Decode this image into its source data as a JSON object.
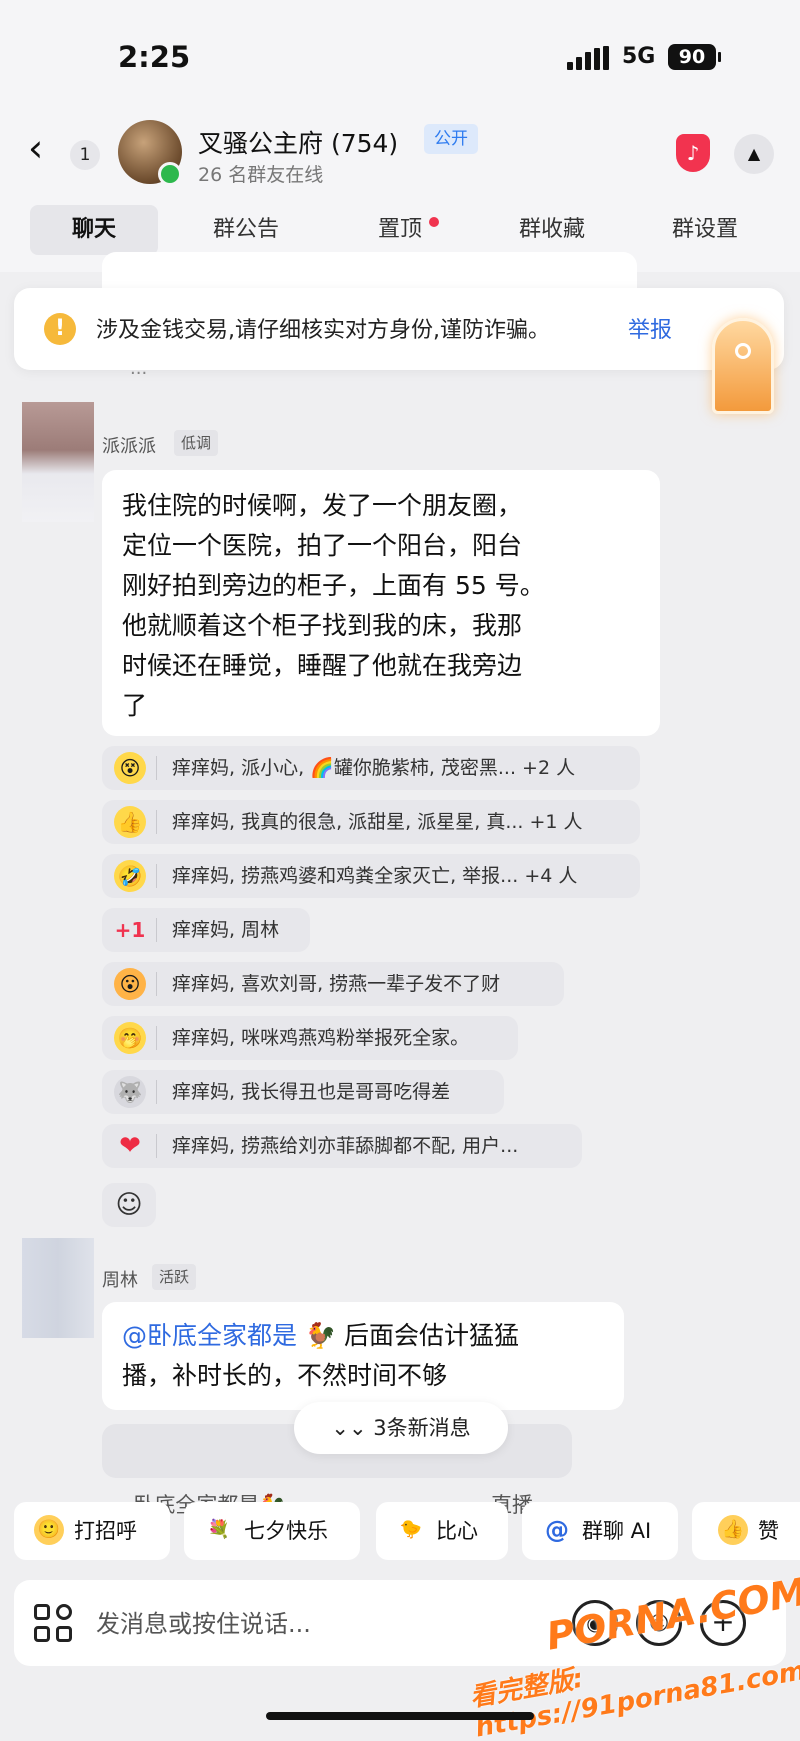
{
  "status": {
    "time": "2:25",
    "network": "5G",
    "battery": "90"
  },
  "header": {
    "back_count": "1",
    "group_name": "叉骚公主府 (754)",
    "public_badge": "公开",
    "online_status": "26 名群友在线"
  },
  "tabs": [
    {
      "label": "聊天",
      "active": true
    },
    {
      "label": "群公告",
      "active": false
    },
    {
      "label": "置顶",
      "active": false,
      "dot": true
    },
    {
      "label": "群收藏",
      "active": false
    },
    {
      "label": "群设置",
      "active": false
    }
  ],
  "previous_message": {
    "text": "..."
  },
  "warning": {
    "text": "涉及金钱交易,请仔细核实对方身份,谨防诈骗。",
    "link": "举报"
  },
  "messages": [
    {
      "sender": "派派派",
      "badge": "低调",
      "text": "我住院的时候啊，发了一个朋友圈，\n定位一个医院，拍了一个阳台，阳台\n刚好拍到旁边的柜子，上面有 55 号。\n他就顺着这个柜子找到我的床，我那\n时候还在睡觉，睡醒了他就在我旁边\n了",
      "reactions": [
        {
          "emoji": "😵",
          "text": "痒痒妈, 派小心, 🌈罐你脆紫柿, 茂密黑... +2 人"
        },
        {
          "emoji": "👍",
          "text": "痒痒妈, 我真的很急, 派甜星, 派星星, 真... +1 人"
        },
        {
          "emoji": "🤣",
          "text": "痒痒妈, 捞燕鸡婆和鸡粪全家灭亡, 举报... +4 人"
        },
        {
          "emoji": "+1",
          "text": "痒痒妈, 周林"
        },
        {
          "emoji": "😮",
          "text": "痒痒妈, 喜欢刘哥, 捞燕一辈子发不了财"
        },
        {
          "emoji": "🤭",
          "text": "痒痒妈, 咪咪鸡燕鸡粉举报死全家。"
        },
        {
          "emoji": "🐺",
          "text": "痒痒妈, 我长得丑也是哥哥吃得差"
        },
        {
          "emoji": "❤",
          "text": "痒痒妈, 捞燕给刘亦菲舔脚都不配, 用户..."
        }
      ]
    },
    {
      "sender": "周林",
      "badge": "活跃",
      "mention": "@卧底全家都是",
      "text_line1": " 后面会估计猛猛",
      "text_line2": "播，补时长的，不然时间不够",
      "quoted": "卧底全家都是🐓",
      "quoted_tail": "直播。"
    }
  ],
  "new_messages": "3条新消息",
  "quick_actions": [
    {
      "label": "打招呼",
      "icon": "🙂"
    },
    {
      "label": "七夕快乐",
      "icon": "💐"
    },
    {
      "label": "比心",
      "icon": "🐤"
    },
    {
      "label": "群聊 AI",
      "icon": "@"
    },
    {
      "label": "赞",
      "icon": "👍"
    }
  ],
  "input": {
    "placeholder": "发消息或按住说话..."
  },
  "watermark": {
    "line1": "PORNA.COM",
    "line2": "看完整版: https://91porna81.com"
  },
  "colors": {
    "accent": "#2f6ae0",
    "online": "#2db84d",
    "warning": "#f6b93b",
    "tiktok": "#f2334f"
  }
}
